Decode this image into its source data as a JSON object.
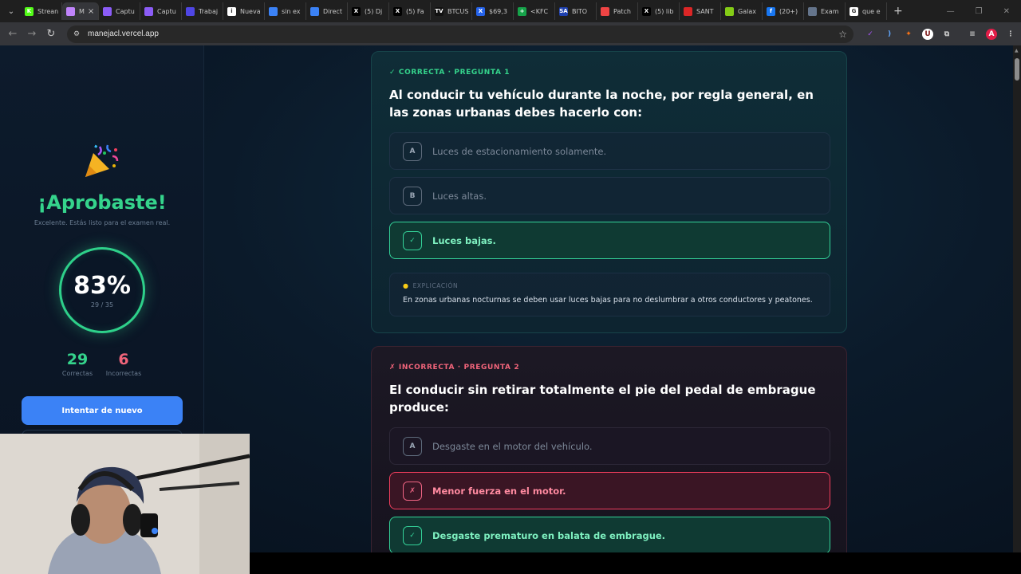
{
  "browser": {
    "tabs": [
      {
        "label": "Strean",
        "fav_color": "#53fc18",
        "fav_glyph": "K"
      },
      {
        "label": "M",
        "fav_color": "#c084fc",
        "fav_glyph": "",
        "active": true
      },
      {
        "label": "Captu",
        "fav_color": "#8b5cf6",
        "fav_glyph": ""
      },
      {
        "label": "Captu",
        "fav_color": "#8b5cf6",
        "fav_glyph": ""
      },
      {
        "label": "Trabaj",
        "fav_color": "#4f46e5",
        "fav_glyph": ""
      },
      {
        "label": "Nueva",
        "fav_color": "#ffffff",
        "fav_glyph": "i"
      },
      {
        "label": "sin ex",
        "fav_color": "#3b82f6",
        "fav_glyph": ""
      },
      {
        "label": "Direct",
        "fav_color": "#3b82f6",
        "fav_glyph": ""
      },
      {
        "label": "(5) Dj",
        "fav_color": "#000000",
        "fav_glyph": "X"
      },
      {
        "label": "(5) Fa",
        "fav_color": "#000000",
        "fav_glyph": "X"
      },
      {
        "label": "BTCUS",
        "fav_color": "#111111",
        "fav_glyph": "TV"
      },
      {
        "label": "$69,3",
        "fav_color": "#2563eb",
        "fav_glyph": "X"
      },
      {
        "label": "<KFC",
        "fav_color": "#16a34a",
        "fav_glyph": "+"
      },
      {
        "label": "BITO",
        "fav_color": "#1e40af",
        "fav_glyph": "SA"
      },
      {
        "label": "Patch",
        "fav_color": "#ef4444",
        "fav_glyph": ""
      },
      {
        "label": "(5) lib",
        "fav_color": "#000000",
        "fav_glyph": "X"
      },
      {
        "label": "SANT",
        "fav_color": "#dc2626",
        "fav_glyph": ""
      },
      {
        "label": "Galax",
        "fav_color": "#84cc16",
        "fav_glyph": ""
      },
      {
        "label": "(20+)",
        "fav_color": "#1877f2",
        "fav_glyph": "f"
      },
      {
        "label": "Exam",
        "fav_color": "#64748b",
        "fav_glyph": ""
      },
      {
        "label": "que e",
        "fav_color": "#ffffff",
        "fav_glyph": "G"
      }
    ],
    "url": "manejacl.vercel.app",
    "profile_initial": "A"
  },
  "sidebar": {
    "title": "¡Aprobaste!",
    "subtitle": "Excelente. Estás listo para el examen real.",
    "score_pct": "83%",
    "score_fraction": "29 / 35",
    "correct_count": "29",
    "correct_label": "Correctas",
    "incorrect_count": "6",
    "incorrect_label": "Incorrectas",
    "retry_label": "Intentar de nuevo",
    "colors": {
      "accent_green": "#35d48c",
      "accent_red": "#f0647a",
      "button_blue": "#3b82f6"
    }
  },
  "questions": [
    {
      "tag": "✓ CORRECTA · PREGUNTA 1",
      "text": "Al conducir tu vehículo durante la noche, por regla general, en las zonas urbanas debes hacerlo con:",
      "options": [
        {
          "key": "A",
          "text": "Luces de estacionamiento solamente."
        },
        {
          "key": "B",
          "text": "Luces altas."
        },
        {
          "key": "✓",
          "text": "Luces bajas."
        }
      ],
      "explanation_label": "EXPLICACIÓN",
      "explanation": "En zonas urbanas nocturnas se deben usar luces bajas para no deslumbrar a otros conductores y peatones."
    },
    {
      "tag": "✗ INCORRECTA · PREGUNTA 2",
      "text": "El conducir sin retirar totalmente el pie del pedal de embrague produce:",
      "options": [
        {
          "key": "A",
          "text": "Desgaste en el motor del vehículo."
        },
        {
          "key": "✗",
          "text": "Menor fuerza en el motor."
        },
        {
          "key": "✓",
          "text": "Desgaste prematuro en balata de embrague."
        }
      ]
    }
  ]
}
